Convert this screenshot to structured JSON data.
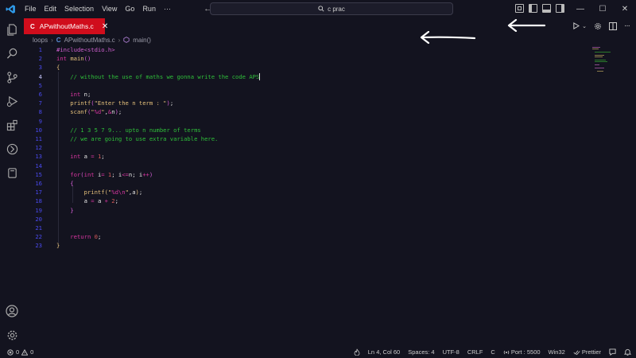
{
  "menu": [
    "File",
    "Edit",
    "Selection",
    "View",
    "Go",
    "Run",
    "···"
  ],
  "command_center": {
    "label": "c prac",
    "icon": "search-icon"
  },
  "nav": {
    "back": "←",
    "forward": "→"
  },
  "activity_bar": {
    "items": [
      "explorer-icon",
      "search-icon",
      "source-control-icon",
      "run-debug-icon",
      "extensions-icon",
      "remote-explorer-icon",
      "testing-icon"
    ],
    "bottom": [
      "account-icon",
      "settings-gear-icon"
    ]
  },
  "tab": {
    "lang_glyph": "C",
    "label": "APwithoutMaths.c",
    "close": "✕",
    "color": "#d00d1c"
  },
  "breadcrumb": {
    "folder": "loops",
    "lang_glyph": "C",
    "file": "APwithoutMaths.c",
    "symbol": "main()"
  },
  "editor": {
    "current_line": 4,
    "lines": [
      {
        "n": "1",
        "tokens": [
          [
            "c-pp",
            "#include<stdio.h>"
          ]
        ]
      },
      {
        "n": "2",
        "tokens": [
          [
            "c-kw2",
            "int "
          ],
          [
            "c-fn",
            "main"
          ],
          [
            "c-br2",
            "()"
          ]
        ]
      },
      {
        "n": "3",
        "tokens": [
          [
            "c-br",
            "{"
          ]
        ]
      },
      {
        "n": "4",
        "tokens": [
          [
            "c-cm",
            "    // without the use of maths we gonna write the code APS"
          ]
        ]
      },
      {
        "n": "5",
        "tokens": []
      },
      {
        "n": "6",
        "tokens": [
          [
            "c-kw2",
            "    int "
          ],
          [
            "c-pl",
            "n;"
          ]
        ]
      },
      {
        "n": "7",
        "tokens": [
          [
            "c-fn",
            "    printf"
          ],
          [
            "c-br2",
            "("
          ],
          [
            "c-str",
            "\"Enter the n term : \""
          ],
          [
            "c-br2",
            ")"
          ],
          [
            "c-pl",
            ";"
          ]
        ]
      },
      {
        "n": "8",
        "tokens": [
          [
            "c-fn",
            "    scanf"
          ],
          [
            "c-br2",
            "("
          ],
          [
            "c-str",
            "\""
          ],
          [
            "c-op",
            "%d"
          ],
          [
            "c-str",
            "\""
          ],
          [
            "c-pl",
            ","
          ],
          [
            "c-op",
            "&"
          ],
          [
            "c-pl",
            "n"
          ],
          [
            "c-br2",
            ")"
          ],
          [
            "c-pl",
            ";"
          ]
        ]
      },
      {
        "n": "9",
        "tokens": []
      },
      {
        "n": "10",
        "tokens": [
          [
            "c-cm",
            "    // 1 3 5 7 9... upto n number of terms"
          ]
        ]
      },
      {
        "n": "11",
        "tokens": [
          [
            "c-cm",
            "    // we are going to use extra variable here."
          ]
        ]
      },
      {
        "n": "12",
        "tokens": []
      },
      {
        "n": "13",
        "tokens": [
          [
            "c-kw2",
            "    int "
          ],
          [
            "c-pl",
            "a "
          ],
          [
            "c-op",
            "= "
          ],
          [
            "c-num",
            "1"
          ],
          [
            "c-pl",
            ";"
          ]
        ]
      },
      {
        "n": "14",
        "tokens": []
      },
      {
        "n": "15",
        "tokens": [
          [
            "c-kw2",
            "    for"
          ],
          [
            "c-br2",
            "("
          ],
          [
            "c-kw2",
            "int "
          ],
          [
            "c-pl",
            "i"
          ],
          [
            "c-op",
            "= "
          ],
          [
            "c-num",
            "1"
          ],
          [
            "c-pl",
            "; i"
          ],
          [
            "c-op",
            "<="
          ],
          [
            "c-pl",
            "n; i"
          ],
          [
            "c-op",
            "++"
          ],
          [
            "c-br2",
            ")"
          ]
        ]
      },
      {
        "n": "16",
        "tokens": [
          [
            "c-br2",
            "    {"
          ]
        ]
      },
      {
        "n": "17",
        "tokens": [
          [
            "c-fn",
            "        printf"
          ],
          [
            "c-br",
            "("
          ],
          [
            "c-str",
            "\""
          ],
          [
            "c-op",
            "%d\\n"
          ],
          [
            "c-str",
            "\""
          ],
          [
            "c-pl",
            ",a"
          ],
          [
            "c-br",
            ")"
          ],
          [
            "c-pl",
            ";"
          ]
        ]
      },
      {
        "n": "18",
        "tokens": [
          [
            "c-pl",
            "        a "
          ],
          [
            "c-op",
            "= "
          ],
          [
            "c-pl",
            "a "
          ],
          [
            "c-op",
            "+ "
          ],
          [
            "c-num",
            "2"
          ],
          [
            "c-pl",
            ";"
          ]
        ]
      },
      {
        "n": "19",
        "tokens": [
          [
            "c-br2",
            "    }"
          ]
        ]
      },
      {
        "n": "20",
        "tokens": []
      },
      {
        "n": "21",
        "tokens": []
      },
      {
        "n": "22",
        "tokens": [
          [
            "c-kw2",
            "    return "
          ],
          [
            "c-num",
            "0"
          ],
          [
            "c-pl",
            ";"
          ]
        ]
      },
      {
        "n": "23",
        "tokens": [
          [
            "c-br",
            "}"
          ]
        ]
      }
    ]
  },
  "status": {
    "errors": "0",
    "warnings": "0",
    "position": "Ln 4, Col 60",
    "spaces": "Spaces: 4",
    "encoding": "UTF-8",
    "eol": "CRLF",
    "language": "C",
    "port": "Port : 5500",
    "platform": "Win32",
    "formatter": "Prettier"
  }
}
